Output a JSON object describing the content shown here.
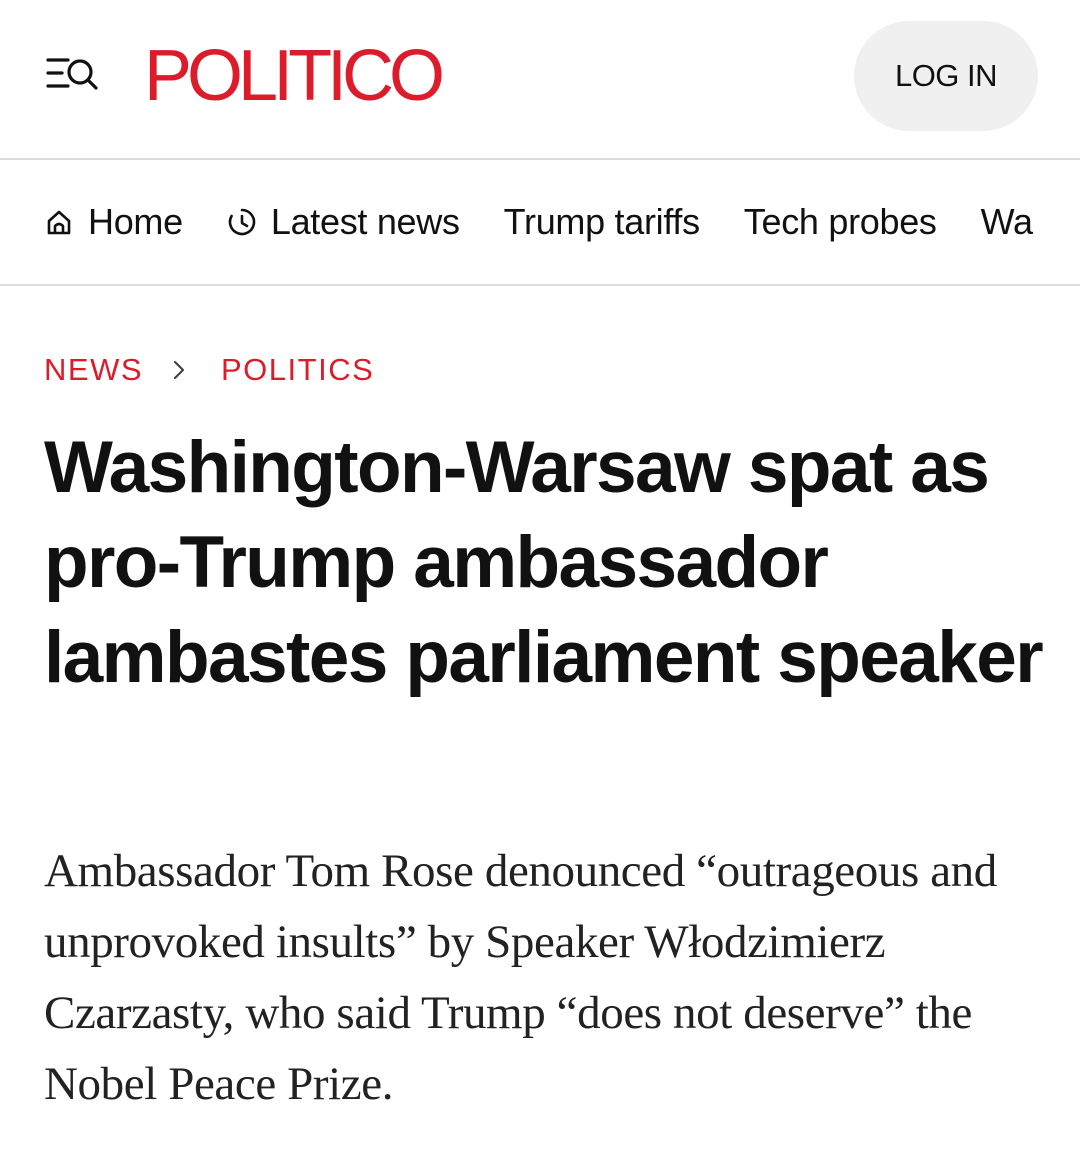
{
  "header": {
    "logo": "POLITICO",
    "login_label": "LOG IN",
    "menu_icon": "menu-search-icon"
  },
  "nav": {
    "items": [
      {
        "label": "Home",
        "icon": "home-icon"
      },
      {
        "label": "Latest news",
        "icon": "clock-icon"
      },
      {
        "label": "Trump tariffs"
      },
      {
        "label": "Tech probes"
      },
      {
        "label": "Wa"
      }
    ]
  },
  "breadcrumb": {
    "section": "NEWS",
    "subsection": "POLITICS"
  },
  "article": {
    "headline": "Washington-Warsaw spat as pro-Trump ambassador lambastes parliament speaker",
    "dek": "Ambassador Tom Rose denounced “outrageous and unprovoked insults” by Speaker Włodzimierz Czarzasty, who said Trump “does not deserve” the Nobel Peace Prize."
  },
  "colors": {
    "brand_red": "#dc1c2b",
    "text": "#111111",
    "button_bg": "#f0f0f0",
    "divider": "#dcdcdc"
  }
}
